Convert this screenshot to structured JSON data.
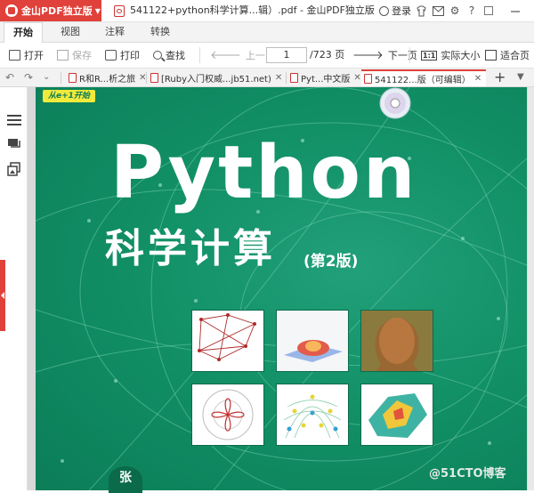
{
  "app": {
    "name": "金山PDF独立版",
    "window_title": "541122+python科学计算...辑）.pdf - 金山PDF独立版",
    "login_label": "登录"
  },
  "menu_tabs": [
    "开始",
    "视图",
    "注释",
    "转换"
  ],
  "toolbar": {
    "open": "打开",
    "save": "保存",
    "print": "打印",
    "find": "查找",
    "prev_page": "上一页",
    "current_page": "1",
    "total_pages": "/723 页",
    "next_page": "下一页",
    "actual_size": "实际大小",
    "fit_page": "适合页"
  },
  "doc_tabs": [
    {
      "label": "R和R...析之旅",
      "active": false
    },
    {
      "label": "[Ruby入门权威...jb51.net)",
      "active": false
    },
    {
      "label": "Pyt...中文版",
      "active": false
    },
    {
      "label": "541122...版（可编辑）",
      "active": true
    }
  ],
  "cover": {
    "series_banner": "从e+1开始",
    "title_en": "Python",
    "title_cn": "科学计算",
    "edition": "(第2版)",
    "author": "张"
  },
  "watermark": "@51CTO博客",
  "colors": {
    "brand_red": "#e0413a",
    "cover_green": "#129066"
  },
  "icons": [
    "app-logo-icon",
    "pdf-file-icon",
    "user-icon",
    "skin-icon",
    "mail-icon",
    "settings-icon",
    "help-icon",
    "minimize-icon",
    "undo-icon",
    "redo-icon",
    "outline-icon",
    "comments-icon",
    "thumbnails-icon",
    "cd-disc-icon"
  ]
}
